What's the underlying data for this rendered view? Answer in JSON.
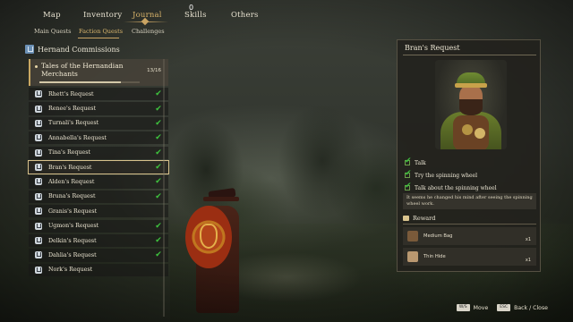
{
  "nav": {
    "tabs": [
      {
        "label": "Map"
      },
      {
        "label": "Inventory"
      },
      {
        "label": "Journal"
      },
      {
        "label": "Skills",
        "count": "0"
      },
      {
        "label": "Others"
      }
    ],
    "active_tab": "Journal",
    "subtabs": [
      {
        "label": "Main Quests"
      },
      {
        "label": "Faction Quests"
      },
      {
        "label": "Challenges"
      }
    ],
    "active_subtab": "Faction Quests"
  },
  "commissions": {
    "header": "Hernand Commissions",
    "category": {
      "title": "Tales of the Hernandian Merchants",
      "count": "13/16",
      "progress": 0.8125
    },
    "quests": [
      {
        "name": "Rhett's Request",
        "done": true
      },
      {
        "name": "Renee's Request",
        "done": true
      },
      {
        "name": "Turnali's Request",
        "done": true
      },
      {
        "name": "Annabella's Request",
        "done": true
      },
      {
        "name": "Tina's Request",
        "done": true
      },
      {
        "name": "Bran's Request",
        "done": true,
        "selected": true
      },
      {
        "name": "Alden's Request",
        "done": true
      },
      {
        "name": "Bruna's Request",
        "done": true
      },
      {
        "name": "Granis's Request",
        "done": false
      },
      {
        "name": "Ugmon's Request",
        "done": true
      },
      {
        "name": "Delkin's Request",
        "done": true
      },
      {
        "name": "Dahlia's Request",
        "done": true
      },
      {
        "name": "Nork's Request",
        "done": false
      }
    ]
  },
  "detail": {
    "title": "Bran's Request",
    "objectives": [
      {
        "text": "Talk",
        "done": true
      },
      {
        "text": "Try the spinning wheel",
        "done": true
      },
      {
        "text": "Talk about the spinning wheel",
        "done": true
      }
    ],
    "description": "It seems he changed his mind after seeing the spinning wheel work.",
    "reward_label": "Reward",
    "rewards": [
      {
        "name": "Medium Bag",
        "qty": "x1",
        "color": "#7a5a3a"
      },
      {
        "name": "Thin Hide",
        "qty": "x1",
        "color": "#b99870"
      }
    ]
  },
  "hints": {
    "move_key": "W/S",
    "move_label": "Move",
    "back_key": "ESC",
    "back_label": "Back / Close"
  },
  "colors": {
    "accent_gold": "#caa463",
    "check_green": "#3ec23e"
  }
}
